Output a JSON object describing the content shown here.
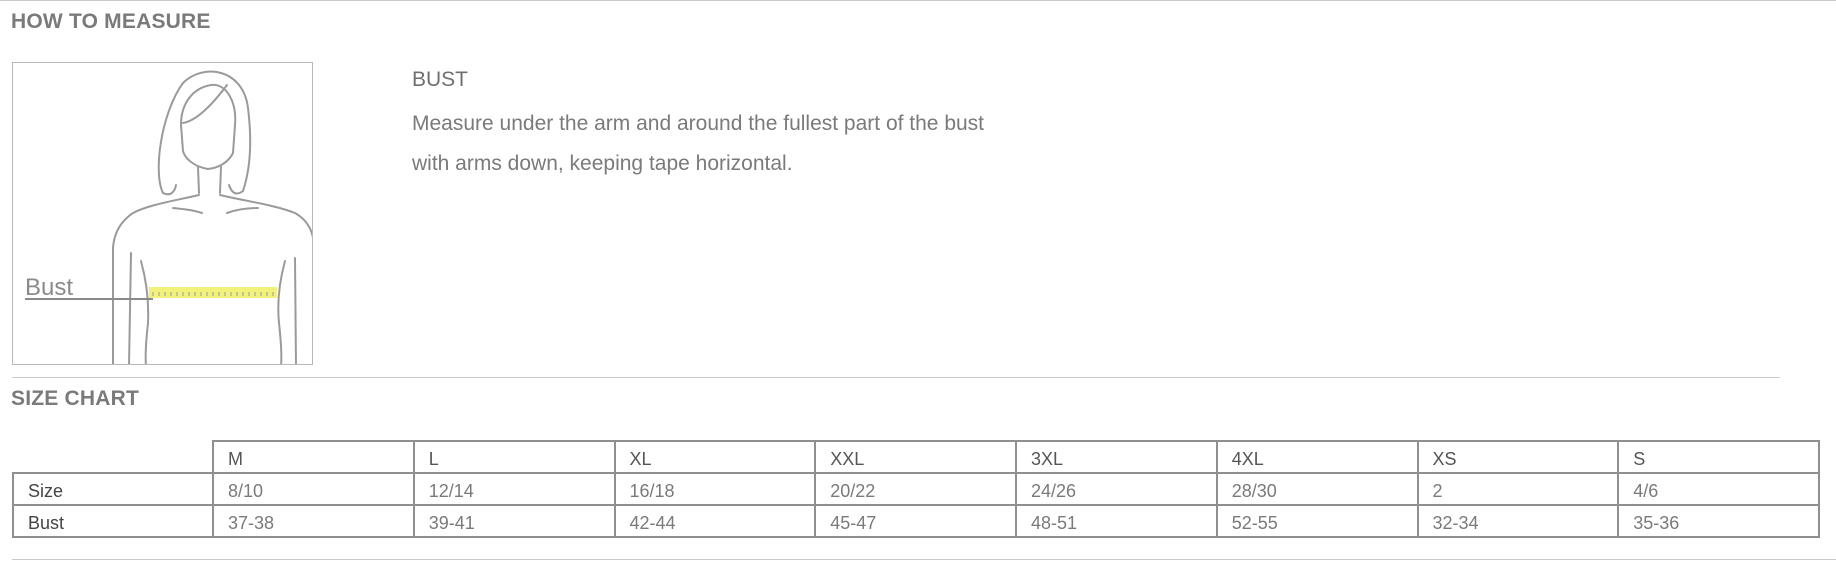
{
  "how_to_measure": {
    "title": "HOW TO MEASURE",
    "illustration_label": "Bust",
    "measure_heading": "BUST",
    "measure_desc_line1": "Measure under the arm and around the fullest part of the bust",
    "measure_desc_line2": "with arms down, keeping tape horizontal.",
    "tape_color": "#f2f27a"
  },
  "size_chart": {
    "title": "SIZE CHART",
    "columns": [
      "M",
      "L",
      "XL",
      "XXL",
      "3XL",
      "4XL",
      "XS",
      "S"
    ],
    "rows": [
      {
        "label": "Size",
        "values": [
          "8/10",
          "12/14",
          "16/18",
          "20/22",
          "24/26",
          "28/30",
          "2",
          "4/6"
        ]
      },
      {
        "label": "Bust",
        "values": [
          "37-38",
          "39-41",
          "42-44",
          "45-47",
          "48-51",
          "52-55",
          "32-34",
          "35-36"
        ]
      }
    ]
  }
}
